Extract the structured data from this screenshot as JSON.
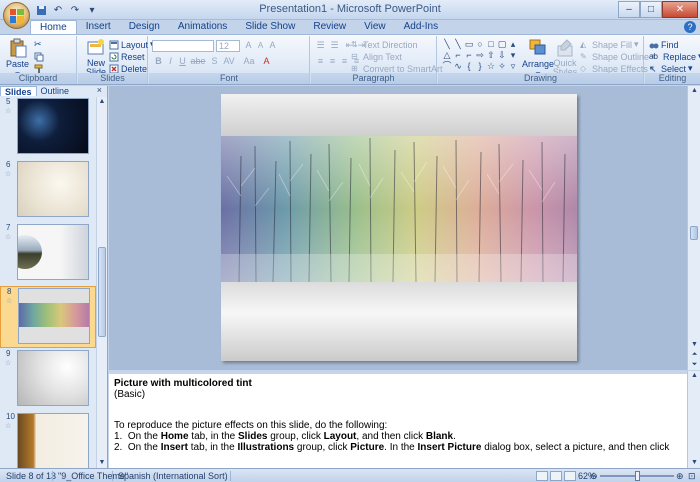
{
  "window": {
    "title": "Presentation1 - Microsoft PowerPoint",
    "buttons": {
      "minimize": "–",
      "maximize": "□",
      "close": "✕"
    }
  },
  "ribbon_tabs": [
    "Home",
    "Insert",
    "Design",
    "Animations",
    "Slide Show",
    "Review",
    "View",
    "Add-Ins"
  ],
  "active_tab": "Home",
  "ribbon": {
    "clipboard": {
      "label": "Clipboard",
      "paste": "Paste"
    },
    "slides": {
      "label": "Slides",
      "new_slide": "New Slide",
      "layout": "Layout",
      "reset": "Reset",
      "delete": "Delete"
    },
    "font": {
      "label": "Font",
      "size": "12",
      "bold": "B",
      "italic": "I",
      "underline": "U",
      "strike": "abe",
      "shadow": "S",
      "spacing": "AV",
      "case": "Aa",
      "grow": "A",
      "shrink": "A",
      "clear": "A"
    },
    "paragraph": {
      "label": "Paragraph",
      "text_direction": "Text Direction",
      "align_text": "Align Text",
      "convert_smartart": "Convert to SmartArt"
    },
    "drawing": {
      "label": "Drawing",
      "arrange": "Arrange",
      "quick_styles": "Quick Styles",
      "shape_fill": "Shape Fill",
      "shape_outline": "Shape Outline",
      "shape_effects": "Shape Effects"
    },
    "editing": {
      "label": "Editing",
      "find": "Find",
      "replace": "Replace",
      "select": "Select"
    }
  },
  "slides_panel": {
    "tabs": [
      "Slides",
      "Outline"
    ],
    "close": "×",
    "thumbs": [
      {
        "num": "5"
      },
      {
        "num": "6"
      },
      {
        "num": "7"
      },
      {
        "num": "8"
      },
      {
        "num": "9"
      },
      {
        "num": "10"
      }
    ],
    "selected_index": 3
  },
  "notes": {
    "title": "Picture with multicolored tint",
    "subtitle": "(Basic)",
    "intro": "To reproduce the picture effects on this slide, do the following:",
    "steps": [
      {
        "n": "1.",
        "parts": [
          "On the ",
          "Home",
          " tab, in the ",
          "Slides",
          " group, click ",
          "Layout",
          ", and then click ",
          "Blank",
          "."
        ]
      },
      {
        "n": "2.",
        "parts": [
          "On the ",
          "Insert",
          " tab, in the ",
          "Illustrations",
          " group, click ",
          "Picture",
          ". In the ",
          "Insert Picture",
          " dialog box, select a picture, and then click"
        ]
      }
    ]
  },
  "status": {
    "slide": "Slide 8 of 13",
    "theme": "\"9_Office Theme\"",
    "language": "Spanish (International Sort)",
    "zoom": "62%",
    "zoom_level": 0.62
  },
  "colors": {
    "ribbon_text": "#15428b",
    "selection": "#fbd990",
    "slide_bg": "#a8bcd8"
  }
}
